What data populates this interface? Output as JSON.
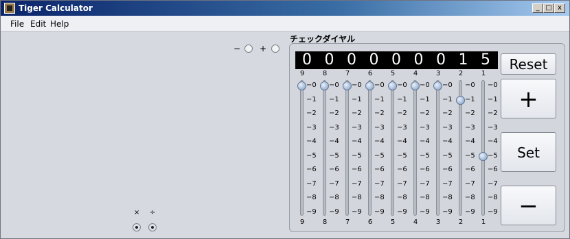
{
  "window": {
    "title": "Tiger Calculator",
    "controls": [
      "_",
      "□",
      "x"
    ]
  },
  "menu": [
    "File",
    "Edit",
    "Help"
  ],
  "sign": {
    "minus": "−",
    "plus": "+"
  },
  "ops": {
    "multiply": "×",
    "divide": "÷"
  },
  "panel": {
    "title": "チェックダイヤル",
    "display_digits": [
      "0",
      "0",
      "0",
      "0",
      "0",
      "0",
      "0",
      "1",
      "5"
    ],
    "column_labels": [
      "9",
      "8",
      "7",
      "6",
      "5",
      "4",
      "3",
      "2",
      "1"
    ],
    "ticks": [
      "−0",
      "−1",
      "−2",
      "−3",
      "−4",
      "−5",
      "−6",
      "−7",
      "−8",
      "−9"
    ],
    "slider_values": [
      0,
      0,
      0,
      0,
      0,
      0,
      0,
      1,
      5
    ]
  },
  "buttons": {
    "reset": "Reset",
    "plus": "+",
    "set": "Set",
    "minus": "−"
  }
}
